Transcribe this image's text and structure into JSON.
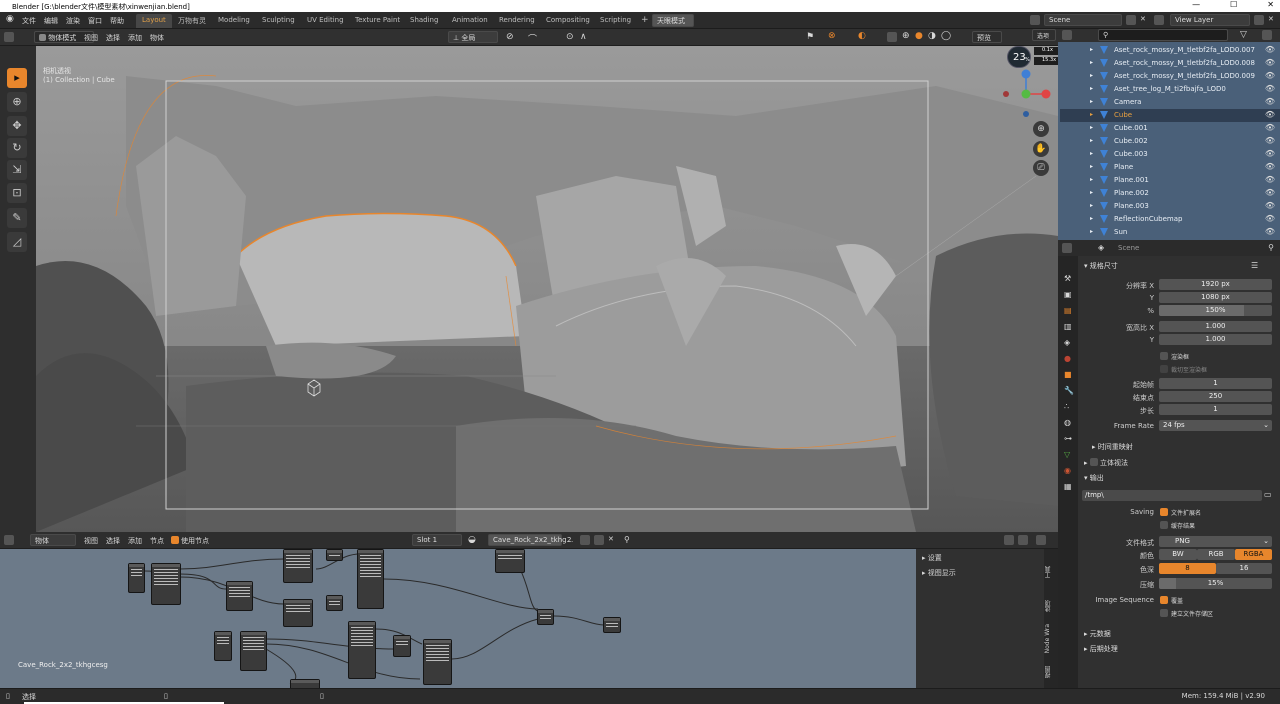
{
  "window": {
    "title": "Blender [G:\\blender文件\\模型素材\\xinwenjian.blend]",
    "min": "—",
    "max": "☐",
    "close": "✕"
  },
  "menu": {
    "items": [
      "文件",
      "编辑",
      "渲染",
      "窗口",
      "帮助"
    ]
  },
  "workspaces": {
    "tabs": [
      "Layout",
      "万物有灵",
      "Modeling",
      "Sculpting",
      "UV Editing",
      "Texture Paint",
      "Shading",
      "Animation",
      "Rendering",
      "Compositing",
      "Scripting"
    ],
    "plus": "+",
    "special": "天眼模式"
  },
  "scene": {
    "name": "Scene",
    "view_layer": "View Layer",
    "options": "选项"
  },
  "viewport": {
    "mode": "物体模式",
    "menus": [
      "视图",
      "选择",
      "添加",
      "物体"
    ],
    "global": "全局",
    "view_name": "相机透视",
    "collection": "(1) Collection | Cube",
    "preview": "预览",
    "zoom": "23",
    "zoom_unit": "%",
    "val1": "0.1",
    "val2": "15.3",
    "val_suffix": "x"
  },
  "outliner": {
    "search_placeholder": "",
    "items": [
      {
        "name": "Aset_rock_mossy_M_tletbf2fa_LOD0.007"
      },
      {
        "name": "Aset_rock_mossy_M_tletbf2fa_LOD0.008"
      },
      {
        "name": "Aset_rock_mossy_M_tletbf2fa_LOD0.009"
      },
      {
        "name": "Aset_tree_log_M_ti2fbajfa_LOD0"
      },
      {
        "name": "Camera"
      },
      {
        "name": "Cube",
        "selected": true
      },
      {
        "name": "Cube.001"
      },
      {
        "name": "Cube.002"
      },
      {
        "name": "Cube.003"
      },
      {
        "name": "Plane"
      },
      {
        "name": "Plane.001"
      },
      {
        "name": "Plane.002"
      },
      {
        "name": "Plane.003"
      },
      {
        "name": "ReflectionCubemap"
      },
      {
        "name": "Sun"
      }
    ]
  },
  "properties": {
    "context": "Scene",
    "dimensions": {
      "title": "规格尺寸",
      "res_x_label": "分辨率 X",
      "res_x": "1920 px",
      "res_y_label": "Y",
      "res_y": "1080 px",
      "pct_label": "%",
      "pct": "150%",
      "pct_fill": 0.75,
      "aspect_x_label": "宽高比 X",
      "aspect_x": "1.000",
      "aspect_y_label": "Y",
      "aspect_y": "1.000",
      "border_label": "渲染框",
      "crop_label": "裁切至渲染框",
      "start_label": "起始帧",
      "start": "1",
      "end_label": "结束点",
      "end": "250",
      "step_label": "步长",
      "step": "1",
      "fps_label": "Frame Rate",
      "fps": "24 fps"
    },
    "time_remap": "时间重映射",
    "stereo": "立体视法",
    "output": {
      "title": "输出",
      "path": "/tmp\\",
      "saving_label": "Saving",
      "file_ext": "文件扩展名",
      "cache": "缓存结果",
      "format_label": "文件格式",
      "format": "PNG",
      "color_label": "颜色",
      "color_opts": [
        "BW",
        "RGB",
        "RGBA"
      ],
      "depth_label": "色深",
      "depth_opts": [
        "8",
        "16"
      ],
      "compress_label": "压缩",
      "compress": "15%",
      "compress_fill": 0.15,
      "seq_label": "Image Sequence",
      "overwrite": "覆盖",
      "placeholders": "建立文件存储区"
    },
    "metadata": "元数据",
    "post": "后期处理"
  },
  "node_editor": {
    "mode": "物体",
    "menus": [
      "视图",
      "选择",
      "添加",
      "节点"
    ],
    "use_nodes": "使用节点",
    "slot": "Slot 1",
    "material": "Cave_Rock_2x2_tkhg...",
    "users": "2",
    "label": "Cave_Rock_2x2_tkhgcesg",
    "sidebar": [
      "设置",
      "视图显示"
    ],
    "tabs": [
      "工具",
      "Node Wra",
      "选项",
      "视图"
    ]
  },
  "status": {
    "left": "选择",
    "mem": "Mem: 159.4 MiB | v2.90"
  },
  "colors": {
    "accent": "#e8862c",
    "select": "#4a6079"
  }
}
